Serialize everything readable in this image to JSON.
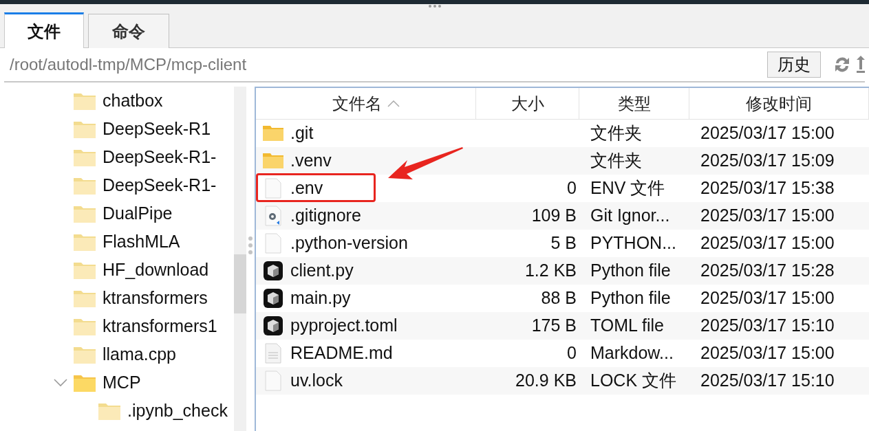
{
  "tabs": [
    {
      "label": "文件",
      "selected": true
    },
    {
      "label": "命令",
      "selected": false
    }
  ],
  "path_field": {
    "value": "/root/autodl-tmp/MCP/mcp-client"
  },
  "history_button": "历史",
  "tree": [
    {
      "label": "chatbox"
    },
    {
      "label": "DeepSeek-R1"
    },
    {
      "label": "DeepSeek-R1-"
    },
    {
      "label": "DeepSeek-R1-"
    },
    {
      "label": "DualPipe"
    },
    {
      "label": "FlashMLA"
    },
    {
      "label": "HF_download"
    },
    {
      "label": "ktransformers"
    },
    {
      "label": "ktransformers1"
    },
    {
      "label": "llama.cpp"
    },
    {
      "label": "MCP",
      "expanded": true,
      "children": [
        {
          "label": ".ipynb_check"
        }
      ]
    }
  ],
  "table": {
    "columns": [
      {
        "label": "文件名",
        "sorted": true
      },
      {
        "label": "大小",
        "sorted": false
      },
      {
        "label": "类型",
        "sorted": false
      },
      {
        "label": "修改时间",
        "sorted": false
      }
    ],
    "rows": [
      {
        "kind": "folder",
        "name": ".git",
        "size": "",
        "type": "文件夹",
        "modified": "2025/03/17 15:00"
      },
      {
        "kind": "folder",
        "name": ".venv",
        "size": "",
        "type": "文件夹",
        "modified": "2025/03/17 15:09"
      },
      {
        "kind": "blank",
        "name": ".env",
        "size": "0",
        "type": "ENV 文件",
        "modified": "2025/03/17 15:38"
      },
      {
        "kind": "config",
        "name": ".gitignore",
        "size": "109 B",
        "type": "Git Ignor...",
        "modified": "2025/03/17 15:00"
      },
      {
        "kind": "blank",
        "name": ".python-version",
        "size": "5 B",
        "type": "PYTHON...",
        "modified": "2025/03/17 15:00"
      },
      {
        "kind": "app",
        "name": "client.py",
        "size": "1.2 KB",
        "type": "Python file",
        "modified": "2025/03/17 15:28"
      },
      {
        "kind": "app",
        "name": "main.py",
        "size": "88 B",
        "type": "Python file",
        "modified": "2025/03/17 15:00"
      },
      {
        "kind": "app",
        "name": "pyproject.toml",
        "size": "175 B",
        "type": "TOML file",
        "modified": "2025/03/17 15:10"
      },
      {
        "kind": "text",
        "name": "README.md",
        "size": "0",
        "type": "Markdow...",
        "modified": "2025/03/17 15:00"
      },
      {
        "kind": "blank",
        "name": "uv.lock",
        "size": "20.9 KB",
        "type": "LOCK 文件",
        "modified": "2025/03/17 15:10"
      }
    ]
  }
}
